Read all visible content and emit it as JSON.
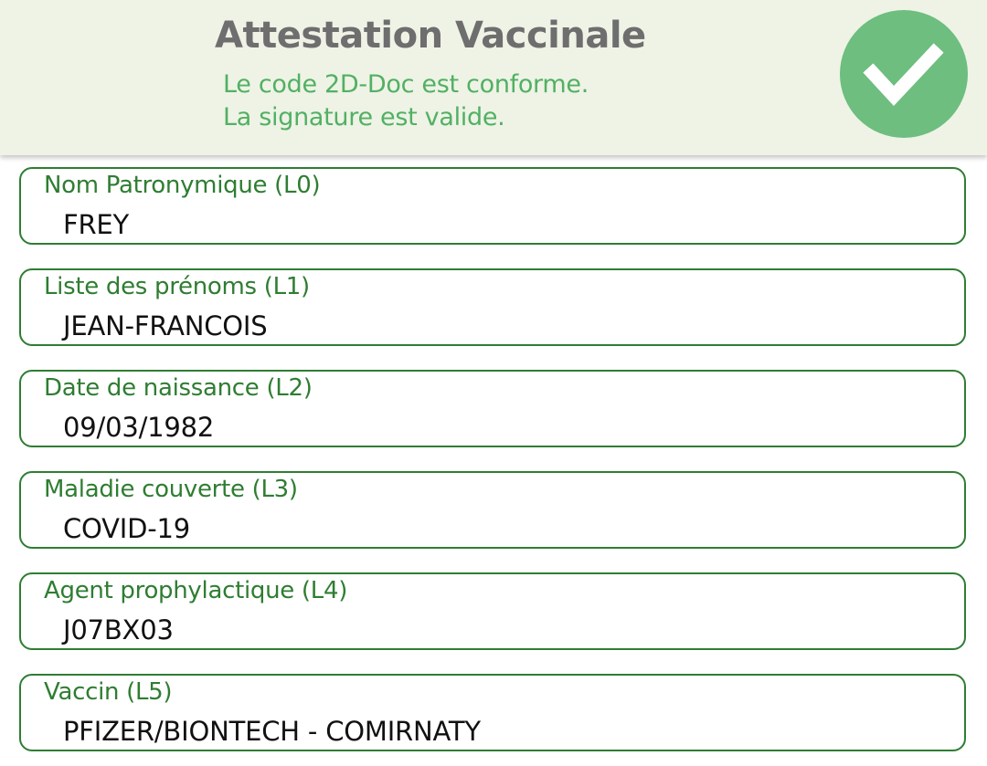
{
  "header": {
    "title": "Attestation Vaccinale",
    "status_line_1": "Le code 2D-Doc est conforme.",
    "status_line_2": "La signature est valide.",
    "status_icon": "checkmark-icon",
    "status_color": "#6dbe7f"
  },
  "fields": [
    {
      "label": "Nom Patronymique (L0)",
      "value": "FREY"
    },
    {
      "label": "Liste des prénoms (L1)",
      "value": "JEAN-FRANCOIS"
    },
    {
      "label": "Date de naissance (L2)",
      "value": "09/03/1982"
    },
    {
      "label": "Maladie couverte (L3)",
      "value": "COVID-19"
    },
    {
      "label": "Agent prophylactique (L4)",
      "value": "J07BX03"
    },
    {
      "label": "Vaccin (L5)",
      "value": "PFIZER/BIONTECH - COMIRNATY"
    }
  ],
  "colors": {
    "header_background": "#eef3e6",
    "field_border": "#2f7d32",
    "field_label": "#2f7d32",
    "status_text": "#52b063",
    "title_text": "#6e6e6e"
  }
}
